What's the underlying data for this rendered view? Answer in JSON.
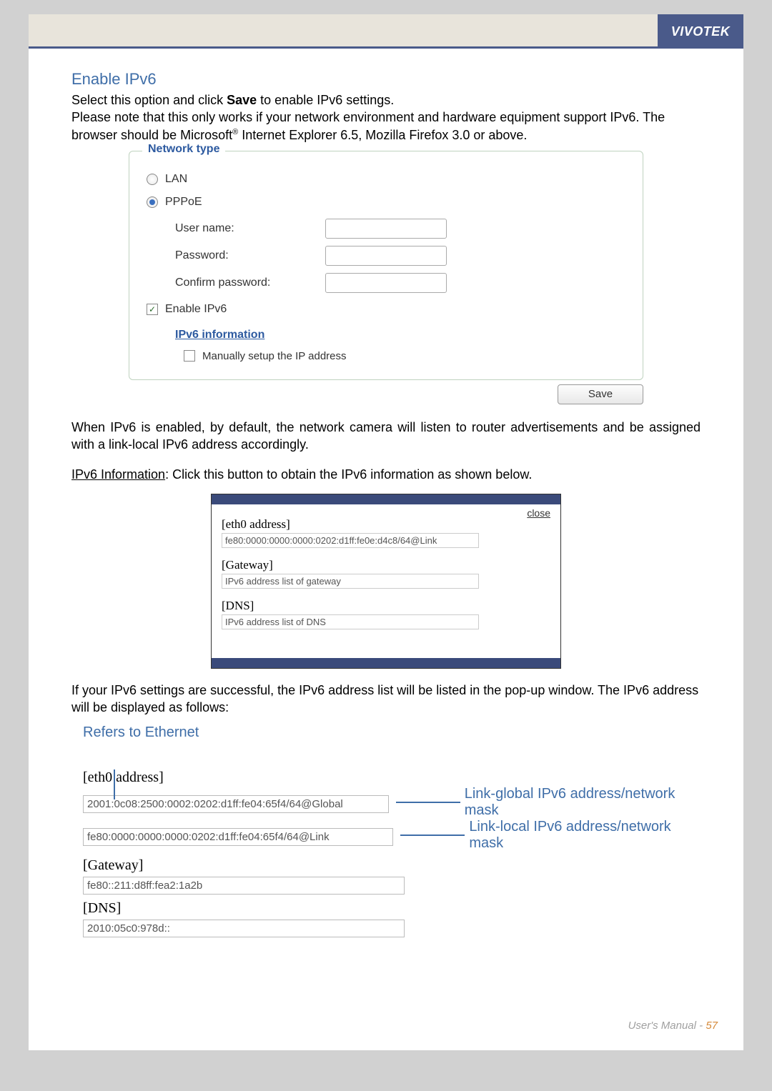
{
  "header": {
    "brand": "VIVOTEK"
  },
  "section": {
    "title": "Enable IPv6",
    "p1a": "Select this option and click ",
    "p1b": "Save",
    "p1c": " to enable IPv6 settings.",
    "p2a": "Please note that this only works if your network environment and hardware equipment support IPv6. The browser should be Microsoft",
    "p2b": " Internet Explorer 6.5, Mozilla Firefox 3.0 or above."
  },
  "panel": {
    "legend": "Network type",
    "lan": "LAN",
    "pppoe": "PPPoE",
    "username": "User name:",
    "password": "Password:",
    "confirm": "Confirm password:",
    "enableipv6": "Enable IPv6",
    "ipv6info": "IPv6 information",
    "manual": "Manually setup the IP address"
  },
  "save": "Save",
  "para2": "When IPv6 is enabled, by default, the network camera will listen to router advertisements and be assigned with a link-local IPv6 address accordingly.",
  "para3a": "IPv6 Information",
  "para3b": ": Click this button to obtain the IPv6 information as shown below.",
  "popup": {
    "close": "close",
    "eth": "[eth0 address]",
    "ethv": "fe80:0000:0000:0000:0202:d1ff:fe0e:d4c8/64@Link",
    "gw": "[Gateway]",
    "gwv": "IPv6 address list of gateway",
    "dns": "[DNS]",
    "dnsv": "IPv6 address list of DNS"
  },
  "para4": "If your IPv6 settings are successful, the IPv6 address list will be listed in the pop-up window. The IPv6 address will be displayed as follows:",
  "refers": "Refers to Ethernet",
  "diagram": {
    "eth": "[eth0 address]",
    "global": "2001:0c08:2500:0002:0202:d1ff:fe04:65f4/64@Global",
    "link": "fe80:0000:0000:0000:0202:d1ff:fe04:65f4/64@Link",
    "gw": "[Gateway]",
    "gwv": "fe80::211:d8ff:fea2:1a2b",
    "dns": "[DNS]",
    "dnsv": "2010:05c0:978d::",
    "annot_global": "Link-global IPv6 address/network mask",
    "annot_link": "Link-local IPv6 address/network mask"
  },
  "footer": {
    "um": "User's Manual - ",
    "pg": "57"
  }
}
